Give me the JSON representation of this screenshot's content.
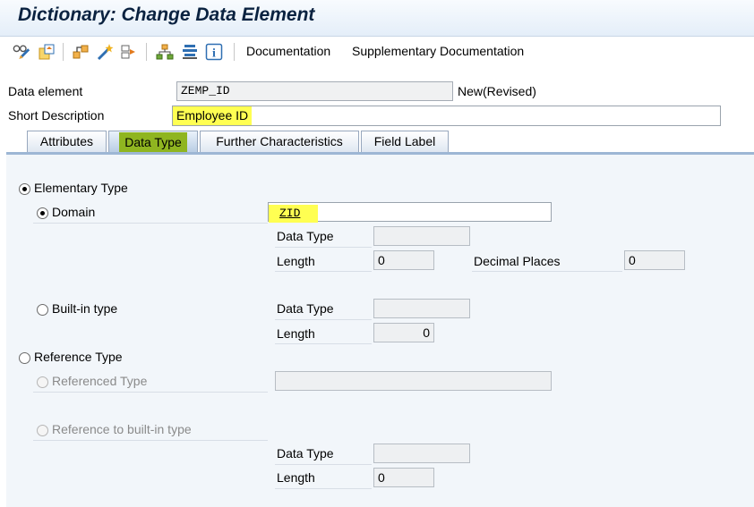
{
  "window": {
    "title": "Dictionary: Change Data Element"
  },
  "toolbar": {
    "icons": [
      "display-change-icon",
      "activate-icon",
      "where-used-icon",
      "magic-wand-icon",
      "object-list-icon",
      "hierarchy-icon",
      "stack-icon",
      "info-icon"
    ],
    "links": {
      "documentation": "Documentation",
      "supplementary": "Supplementary Documentation"
    }
  },
  "header": {
    "data_element_label": "Data element",
    "data_element_value": "ZEMP_ID",
    "status": "New(Revised)",
    "short_desc_label": "Short Description",
    "short_desc_value": "Employee ID"
  },
  "tabs": [
    {
      "label": "Attributes"
    },
    {
      "label": "Data Type"
    },
    {
      "label": "Further Characteristics"
    },
    {
      "label": "Field Label"
    }
  ],
  "active_tab": "Data Type",
  "datatype": {
    "elementary_label": "Elementary Type",
    "domain_label": "Domain",
    "domain_value": "ZID",
    "dt_label": "Data Type",
    "dt_value": "",
    "length_label": "Length",
    "length_value": "0",
    "decimal_label": "Decimal Places",
    "decimal_value": "0",
    "builtin_label": "Built-in type",
    "builtin_dt_label": "Data Type",
    "builtin_dt_value": "",
    "builtin_len_label": "Length",
    "builtin_len_value": "0",
    "reference_label": "Reference Type",
    "ref_type_label": "Referenced Type",
    "ref_type_value": "",
    "ref_builtin_label": "Reference to built-in type",
    "ref_dt_label": "Data Type",
    "ref_dt_value": "",
    "ref_len_label": "Length",
    "ref_len_value": "0"
  },
  "colors": {
    "highlight": "#ffff52",
    "active_tab": "#8fb520",
    "title": "#0a2240"
  }
}
